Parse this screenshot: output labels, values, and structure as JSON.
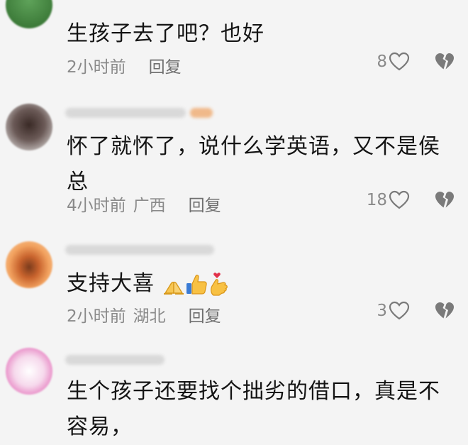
{
  "comments": [
    {
      "text": "生孩子去了吧？也好",
      "time": "2小时前",
      "location": "",
      "reply_label": "回复",
      "likes": "8"
    },
    {
      "text": "怀了就怀了，说什么学英语，又不是侯总",
      "time": "4小时前",
      "location": "广西",
      "reply_label": "回复",
      "likes": "18"
    },
    {
      "text": "支持大喜",
      "emojis": [
        "folded-hands",
        "thumbs-up",
        "finger-heart"
      ],
      "time": "2小时前",
      "location": "湖北",
      "reply_label": "回复",
      "likes": "3"
    },
    {
      "text": "生个孩子还要找个拙劣的借口，真是不容易，"
    }
  ]
}
